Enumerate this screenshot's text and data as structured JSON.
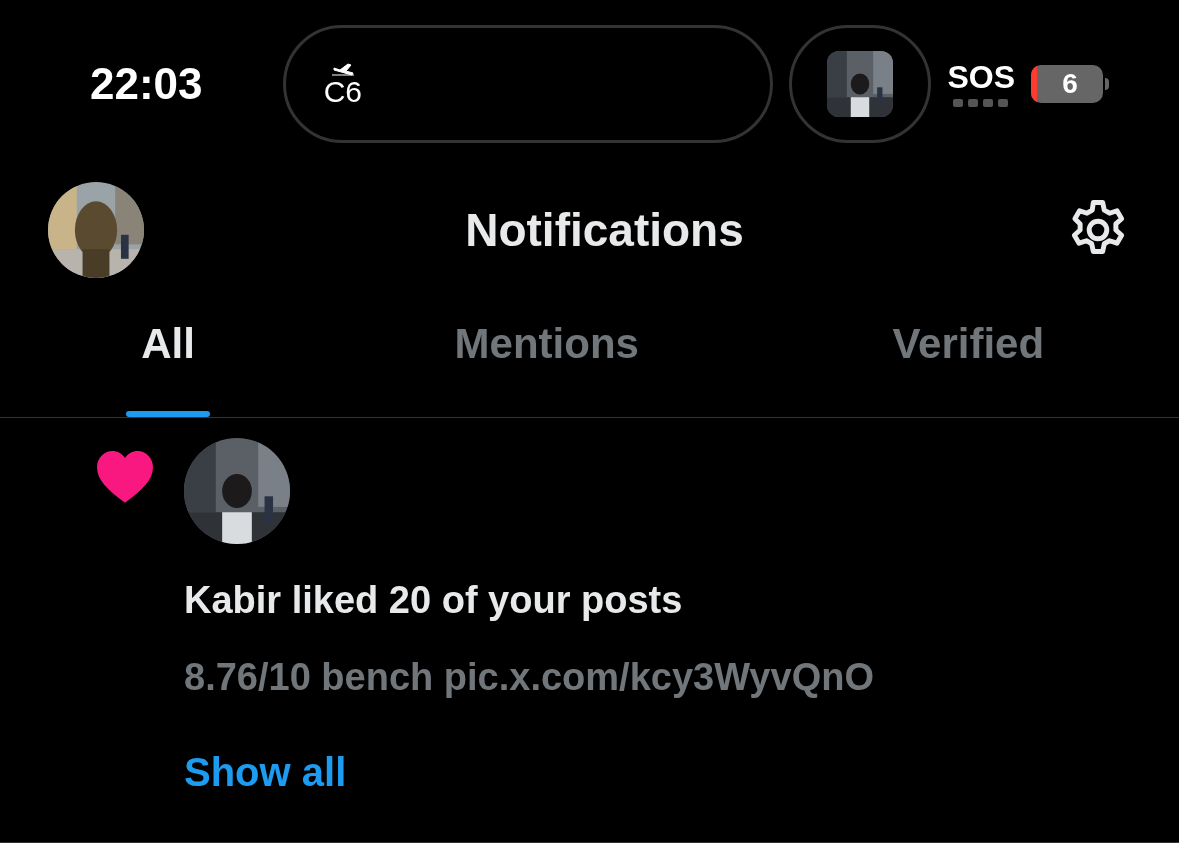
{
  "status_bar": {
    "time": "22:03",
    "island_text": "C6",
    "carrier": "SOS",
    "battery": "6"
  },
  "header": {
    "title": "Notifications"
  },
  "tabs": [
    {
      "label": "All",
      "selected": true
    },
    {
      "label": "Mentions",
      "selected": false
    },
    {
      "label": "Verified",
      "selected": false
    }
  ],
  "notifications": [
    {
      "kind": "like",
      "text": "Kabir liked 20 of your posts",
      "preview": "8.76/10 bench pic.x.com/kcy3WyvQnO",
      "link": "Show all"
    }
  ]
}
